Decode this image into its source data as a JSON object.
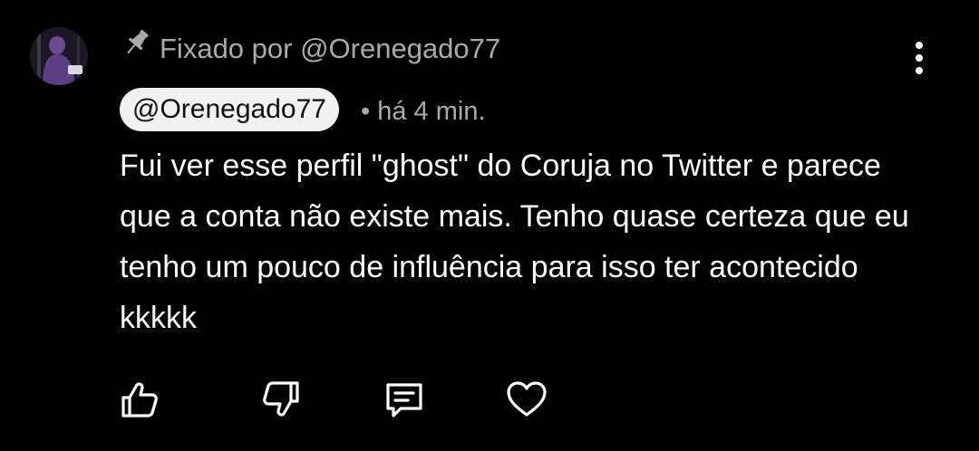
{
  "comment": {
    "pinned_label": "Fixado por @Orenegado77",
    "author": "@Orenegado77",
    "time": "há 4 min.",
    "text": "Fui ver esse perfil \"ghost\" do Coruja no Twitter e parece que a conta não existe mais. Tenho quase certeza que eu tenho um pouco de influência para isso ter acontecido kkkkk"
  },
  "icons": {
    "pin": "pin-icon",
    "more": "more-vert-icon",
    "like": "thumbs-up-icon",
    "dislike": "thumbs-down-icon",
    "reply": "comment-icon",
    "heart": "heart-icon"
  },
  "colors": {
    "background": "#000000",
    "text": "#ffffff",
    "secondary_text": "#aaaaaa",
    "author_chip_bg": "#f1f1f1",
    "author_chip_text": "#0f0f0f"
  }
}
